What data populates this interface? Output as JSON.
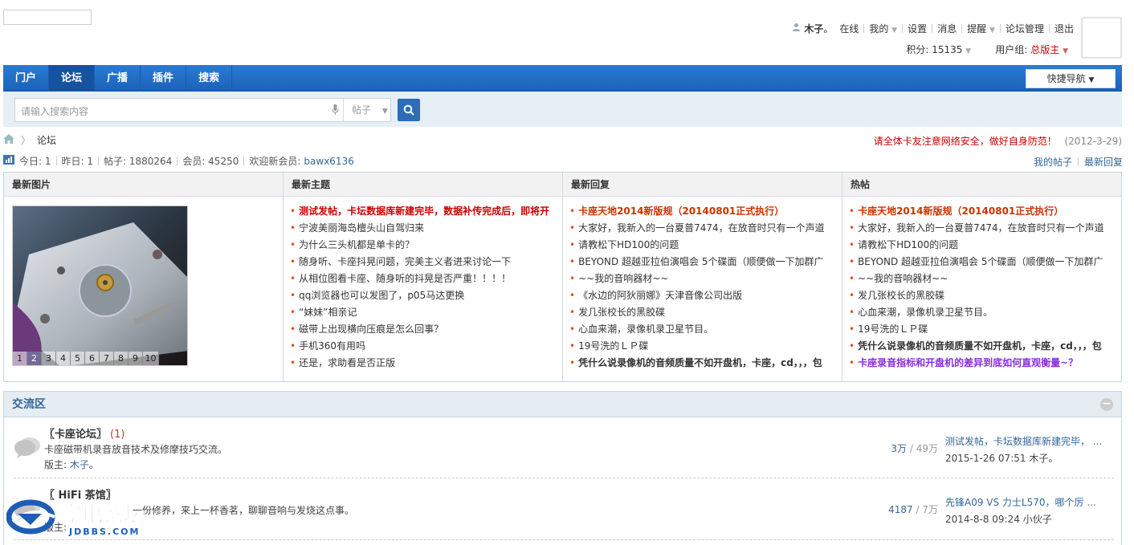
{
  "user": {
    "name": "木子",
    "status": "在线",
    "menu": [
      "我的",
      "设置",
      "消息",
      "提醒",
      "论坛管理",
      "退出"
    ],
    "points_label": "积分: 15135",
    "group_label": "用户组:",
    "group_value": "总版主"
  },
  "nav": {
    "items": [
      "门户",
      "论坛",
      "广播",
      "插件",
      "搜索"
    ],
    "active": "论坛",
    "quick_nav": "快捷导航"
  },
  "search": {
    "placeholder": "请输入搜索内容",
    "scope": "帖子"
  },
  "breadcrumb": {
    "current": "论坛"
  },
  "notice": {
    "text": "请全体卡友注意网络安全，做好自身防范！",
    "date": "(2012-3-29)"
  },
  "stats": {
    "today": "今日: 1",
    "yesterday": "昨日: 1",
    "posts": "帖子: 1880264",
    "members": "会员: 45250",
    "welcome": "欢迎新会员:",
    "new_member": "bawx6136"
  },
  "my_links": [
    "我的帖子",
    "最新回复"
  ],
  "panels": {
    "pics_title": "最新图片",
    "pic_pages": [
      "1",
      "2",
      "3",
      "4",
      "5",
      "6",
      "7",
      "8",
      "9",
      "10"
    ],
    "topics_title": "最新主题",
    "topics": [
      "测试发帖，卡坛数据库新建完毕，数据补传完成后，即将开",
      "宁波美丽海岛檀头山自驾归来",
      "为什么三头机都是单卡的？",
      "随身听、卡座抖晃问题，完美主义者进来讨论一下",
      "从相位图看卡座、随身听的抖晃是否严重！！！！",
      "qq浏览器也可以发图了，p05马达更换",
      "“妹妹”相亲记",
      "磁带上出现横向压痕是怎么回事？",
      "手机360有用吗",
      "还是，求助看是否正版"
    ],
    "replies_title": "最新回复",
    "replies": [
      "卡座天地2014新版规（20140801正式执行）",
      "大家好，我新入的一台夏普7474，在放音时只有一个声道",
      "请教松下HD100的问题",
      "BEYOND 超越亚拉伯演唱会 5个碟面（顺便做一下加群广",
      "~~我的音响器材~~",
      "《水边的阿狄丽娜》天津音像公司出版",
      "发几张校长的黑胶碟",
      "心血来潮，录像机录卫星节目。",
      "19号洗的ＬＰ碟",
      "凭什么说录像机的音频质量不如开盘机，卡座，cd，，，包"
    ],
    "hot_title": "热帖",
    "hot": [
      "卡座天地2014新版规（20140801正式执行）",
      "大家好，我新入的一台夏普7474，在放音时只有一个声道",
      "请教松下HD100的问题",
      "BEYOND 超越亚拉伯演唱会 5个碟面（顺便做一下加群广",
      "~~我的音响器材~~",
      "发几张校长的黑胶碟",
      "心血来潮，录像机录卫星节目。",
      "19号洗的ＬＰ碟",
      "凭什么说录像机的音频质量不如开盘机，卡座，cd，，，包",
      "卡座录音指标和开盘机的差异到底如何直观衡量~？"
    ]
  },
  "section": {
    "title": "交流区",
    "forums": [
      {
        "name": "〖卡座论坛〗",
        "count": "(1)",
        "desc": "卡座磁带机录音放音技术及修摩技巧交流。",
        "mod_label": "版主:",
        "mod": "木子",
        "threads": "3万",
        "posts": "49万",
        "last_title": "测试发帖，卡坛数据库新建完毕， ...",
        "last_date": "2015-1-26 07:51",
        "last_user": "木子"
      },
      {
        "name": "〖 HiFi 茶馆〗",
        "count": "",
        "desc": "一份修养，来上一杯香茗，聊聊音响与发烧这点事。",
        "mod_label": "版主:",
        "mod": "",
        "threads": "4187",
        "posts": "7万",
        "last_title": "先锋A09 VS 力士L570，哪个厉 ...",
        "last_date": "2014-8-8 09:24",
        "last_user": "小伙子"
      }
    ]
  },
  "watermark": {
    "brand": "家电论坛",
    "url": "JDBBS.COM"
  },
  "colors": {
    "nav_bg": "#1a62ba",
    "accent_red": "#cc3300",
    "link_blue": "#336699"
  }
}
